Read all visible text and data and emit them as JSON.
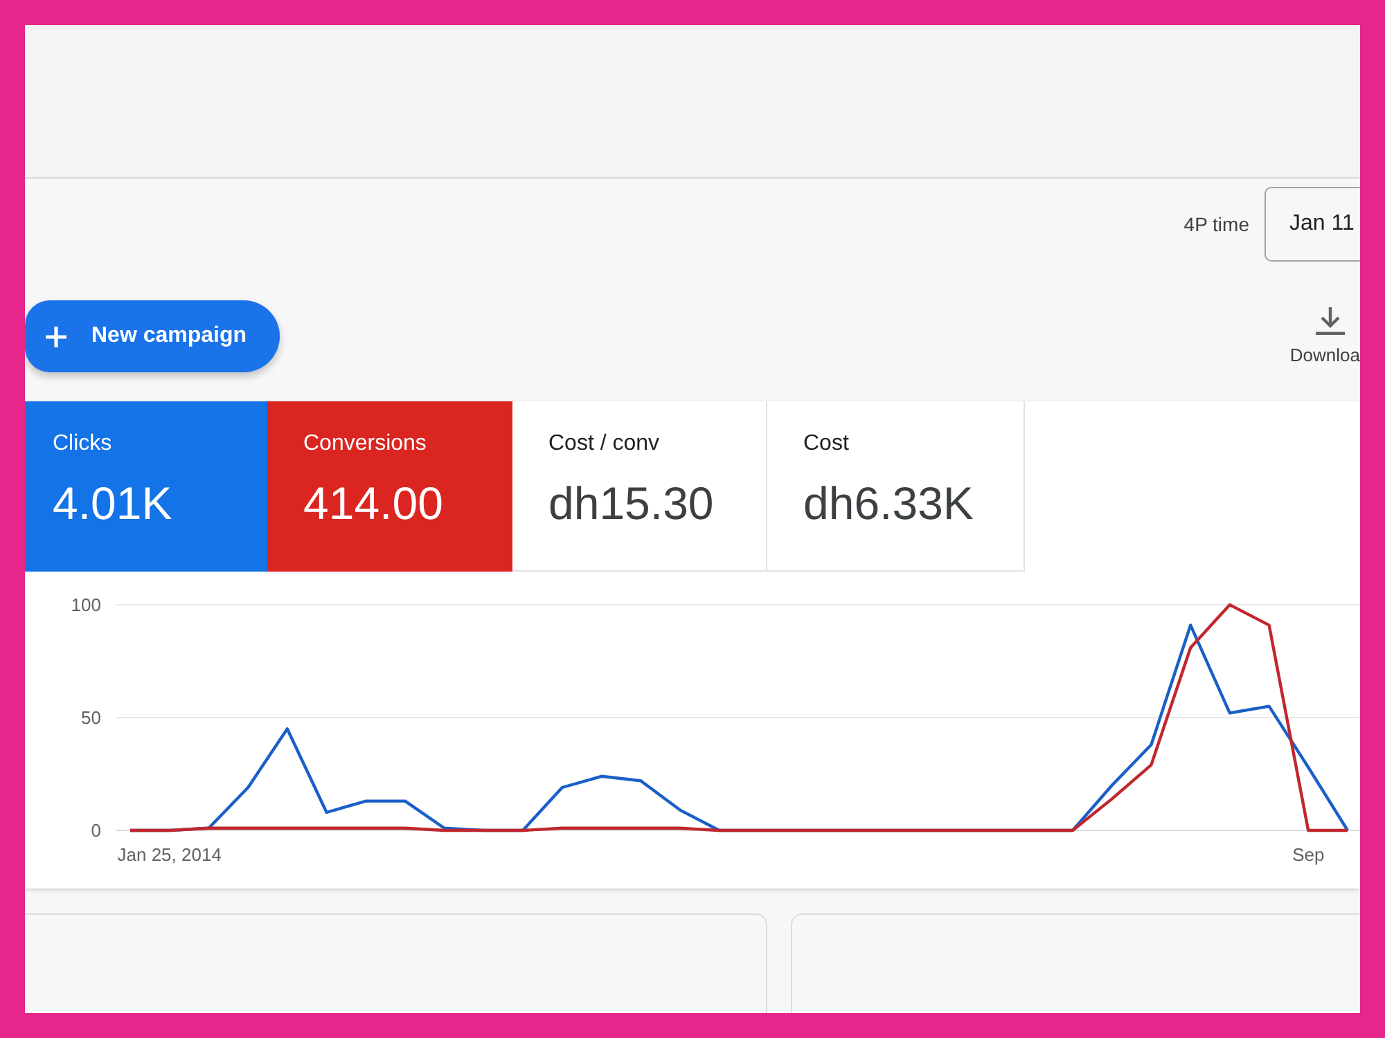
{
  "date_range": {
    "label": "4P time",
    "value": "Jan 11"
  },
  "actions": {
    "new_campaign": "New campaign",
    "download": "Downloa"
  },
  "metrics": [
    {
      "label": "Clicks",
      "value": "4.01K",
      "selected": true,
      "color": "#1473e6"
    },
    {
      "label": "Conversions",
      "value": "414.00",
      "selected": true,
      "color": "#db2520"
    },
    {
      "label": "Cost / conv",
      "value": "dh15.30",
      "selected": false
    },
    {
      "label": "Cost",
      "value": "dh6.33K",
      "selected": false
    }
  ],
  "chart": {
    "chart_data": {
      "type": "line",
      "categories": [
        null,
        "Jan 25, 2014",
        null,
        null,
        null,
        null,
        null,
        null,
        null,
        null,
        null,
        null,
        null,
        null,
        null,
        null,
        null,
        null,
        null,
        null,
        null,
        null,
        null,
        null,
        null,
        null,
        null,
        null,
        null,
        null,
        "Sep",
        null
      ],
      "series": [
        {
          "color": "#1a5fc8",
          "values": [
            0,
            0,
            1,
            19,
            45,
            8,
            13,
            13,
            1,
            0,
            0,
            19,
            24,
            22,
            9,
            0,
            0,
            0,
            0,
            0,
            0,
            0,
            0,
            0,
            0,
            20,
            38,
            91,
            52,
            55,
            28,
            0
          ]
        },
        {
          "color": "#c0272d",
          "values": [
            0,
            0,
            1,
            1,
            1,
            1,
            1,
            1,
            0,
            0,
            0,
            1,
            1,
            1,
            1,
            0,
            0,
            0,
            0,
            0,
            0,
            0,
            0,
            0,
            0,
            14,
            29,
            81,
            100,
            91,
            0,
            0
          ]
        }
      ],
      "ylim": [
        0,
        100
      ],
      "yticks": [
        0,
        50,
        100
      ],
      "grid": true
    }
  }
}
